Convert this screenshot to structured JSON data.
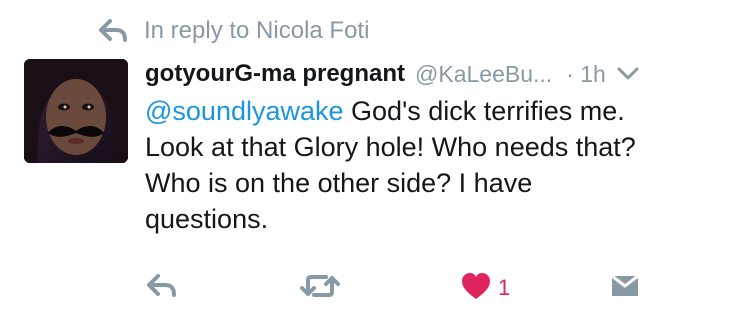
{
  "reply_context": {
    "text": "In reply to Nicola Foti",
    "icon": "reply-arrow-icon"
  },
  "tweet": {
    "display_name": "gotyourG-ma pregnant",
    "screen_name": "@KaLeeBu...",
    "separator_time": "· 1h",
    "mention": "@soundlyawake",
    "text_line1_rest": " God's dick terrifies me.",
    "text_line2": "Look at that Glory hole! Who needs that?",
    "text_line3": "Who is on the other side? I have",
    "text_line4": "questions."
  },
  "actions": {
    "like_count": "1"
  },
  "colors": {
    "muted": "#8899a6",
    "text": "#14171a",
    "link": "#1b95e0",
    "like": "#e0245e"
  }
}
